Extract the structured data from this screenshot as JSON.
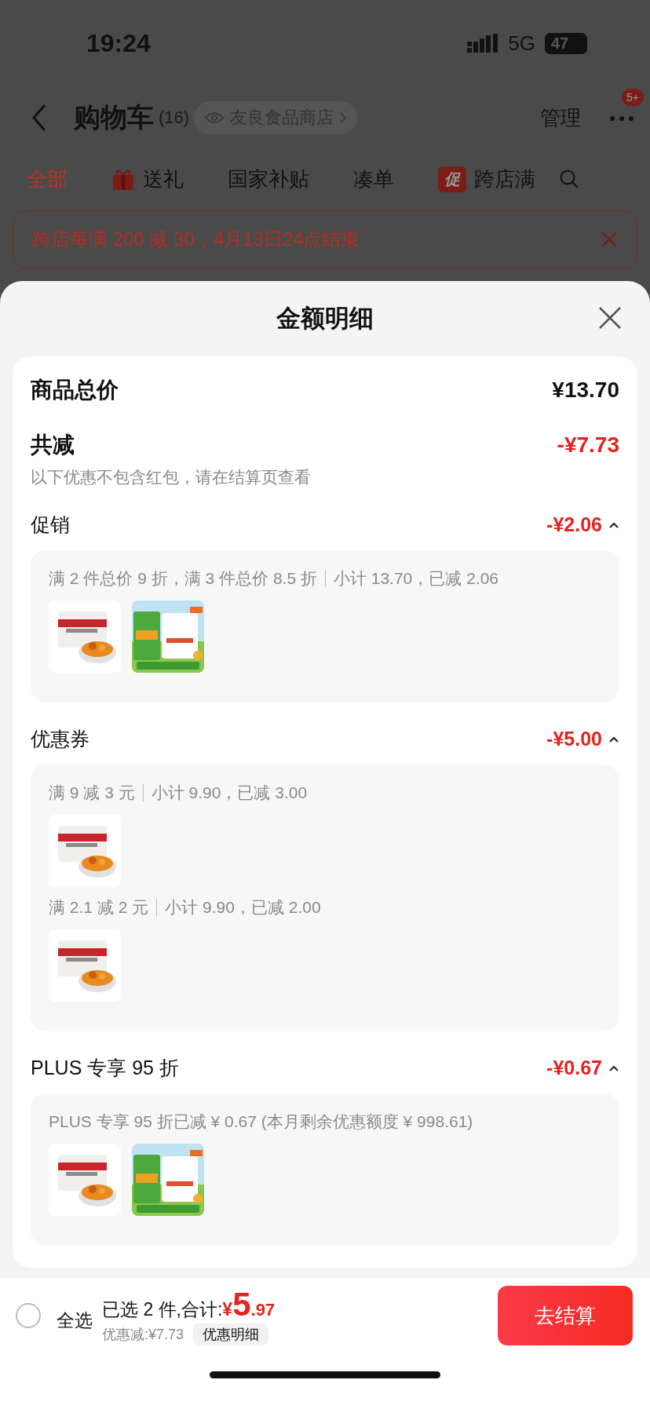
{
  "status_bar": {
    "time": "19:24",
    "network": "5G",
    "battery": "47"
  },
  "header": {
    "title": "购物车",
    "count": "(16)",
    "store": "友良食品商店",
    "manage": "管理",
    "badge": "5+"
  },
  "tabs": [
    {
      "label": "全部",
      "selected": true
    },
    {
      "label": "送礼",
      "selected": false,
      "kind": "gift"
    },
    {
      "label": "国家补贴",
      "selected": false
    },
    {
      "label": "凑单",
      "selected": false
    },
    {
      "label": "跨店满",
      "selected": false,
      "kind": "promo",
      "tag": "促"
    }
  ],
  "banner": {
    "text": "跨店每满 200 减 30，4月13日24点结束"
  },
  "sheet": {
    "title": "金额明细",
    "total": {
      "label": "商品总价",
      "value": "¥13.70"
    },
    "discount": {
      "label": "共减",
      "value": "-¥7.73",
      "note": "以下优惠不包含红包，请在结算页查看"
    },
    "sections": [
      {
        "title": "促销",
        "amount": "-¥2.06",
        "expanded": true,
        "groups": [
          {
            "rule": "满 2 件总价 9 折，满 3 件总价 8.5 折",
            "detail": "小计 13.70，已减 2.06"
          }
        ]
      },
      {
        "title": "优惠券",
        "amount": "-¥5.00",
        "expanded": true,
        "groups": [
          {
            "rule": "满 9 减 3 元",
            "detail": "小计 9.90，已减 3.00"
          },
          {
            "rule": "满 2.1 减 2 元",
            "detail": "小计 9.90，已减 2.00"
          }
        ]
      },
      {
        "title": "PLUS 专享 95 折",
        "amount": "-¥0.67",
        "expanded": true,
        "groups": [
          {
            "rule": "PLUS 专享 95 折已减 ¥ 0.67 (本月剩余优惠额度 ¥ 998.61)"
          }
        ]
      }
    ]
  },
  "bottom_bar": {
    "select_all": {
      "label": "全选",
      "checked": false
    },
    "summary": "已选 2 件,合计:",
    "currency": "¥",
    "price_int": "5",
    "price_dec": ".97",
    "saved": "优惠减:¥7.73",
    "details": "优惠明细",
    "checkout": "去结算"
  }
}
